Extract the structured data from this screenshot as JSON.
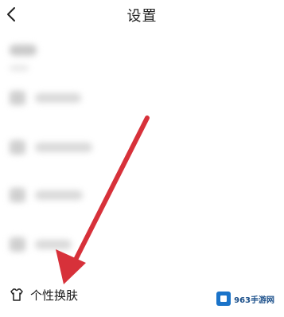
{
  "header": {
    "title": "设置"
  },
  "settings_item": {
    "label": "个性换肤"
  },
  "watermark": {
    "text": "963手游网"
  },
  "icons": {
    "back": "back-chevron-icon",
    "skin": "t-shirt-icon",
    "watermark_logo": "site-logo-icon"
  },
  "colors": {
    "annotation_arrow": "#d7313a"
  }
}
